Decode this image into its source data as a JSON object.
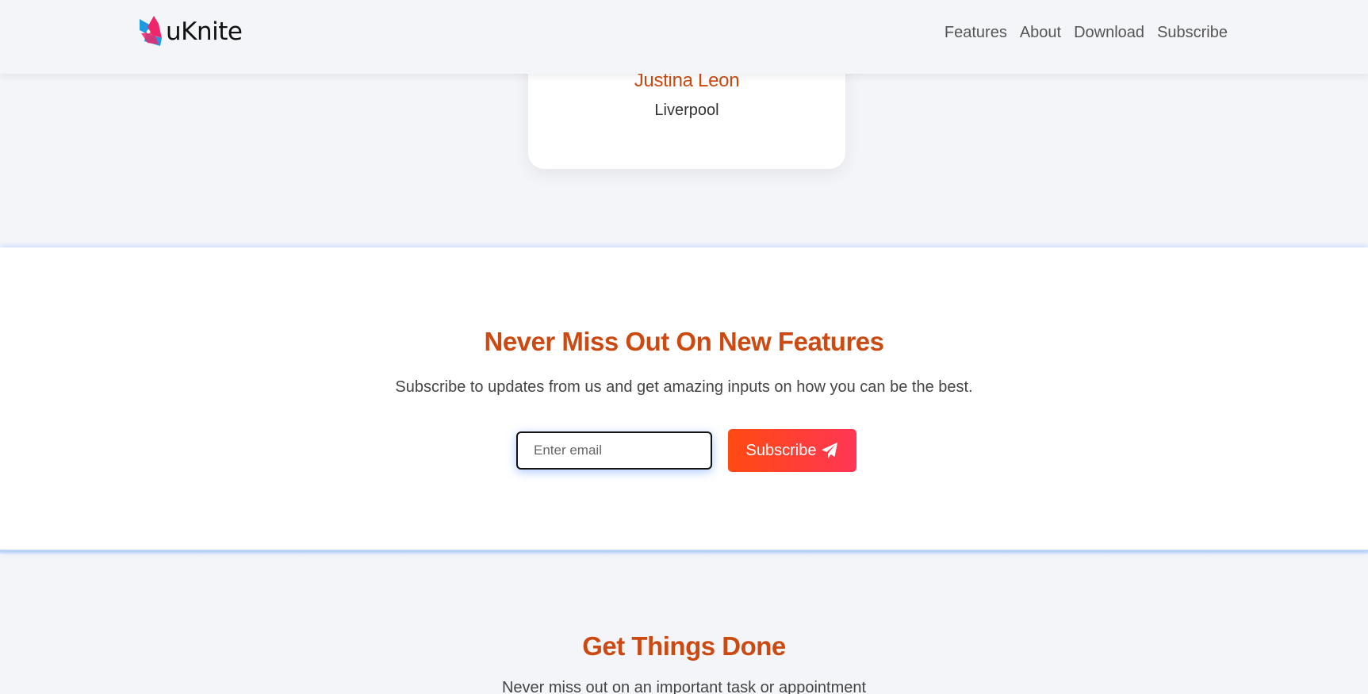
{
  "header": {
    "logo_text": "uKnite",
    "nav": [
      {
        "label": "Features"
      },
      {
        "label": "About"
      },
      {
        "label": "Download"
      },
      {
        "label": "Subscribe"
      }
    ]
  },
  "testimonial": {
    "name": "Justina Leon",
    "city": "Liverpool"
  },
  "subscribe": {
    "title": "Never Miss Out On New Features",
    "text": "Subscribe to updates from us and get amazing inputs on how you can be the best.",
    "email_placeholder": "Enter email",
    "email_value": "",
    "button_label": "Subscribe",
    "button_icon": "paper-plane-icon"
  },
  "get_things_done": {
    "title": "Get Things Done",
    "text": "Never miss out on an important task or appointment"
  },
  "colors": {
    "accent": "#cc4a12",
    "button_start": "#ff4a12",
    "button_end": "#ff3655",
    "logo_blue": "#1e9be0",
    "logo_pink": "#f0266a"
  }
}
